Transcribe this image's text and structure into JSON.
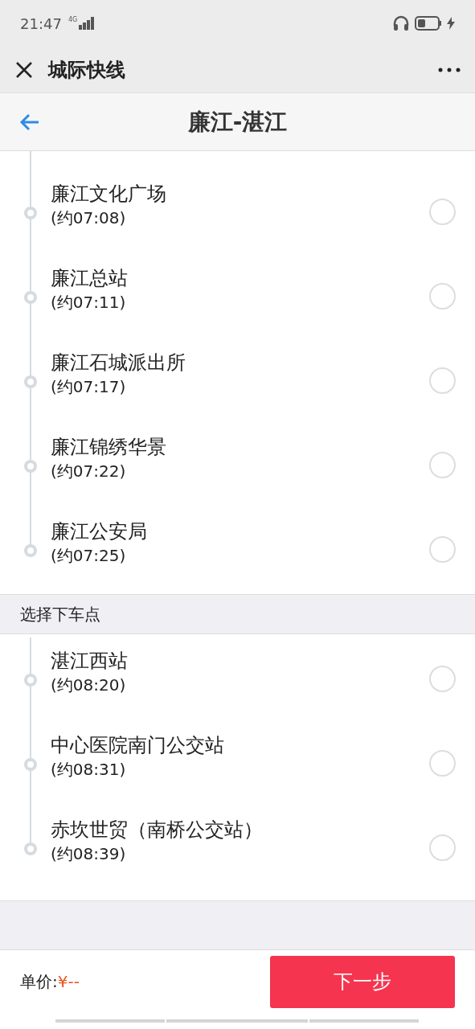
{
  "status_bar": {
    "time": "21:47",
    "network": "4G"
  },
  "title_bar": {
    "title": "城际快线"
  },
  "nav": {
    "title": "廉江-湛江"
  },
  "boarding": {
    "stops": [
      {
        "name": "廉江文化广场",
        "time": "(约07:08)",
        "selected": false
      },
      {
        "name": "廉江总站",
        "time": "(约07:11)",
        "selected": false
      },
      {
        "name": "廉江石城派出所",
        "time": "(约07:17)",
        "selected": false
      },
      {
        "name": "廉江锦绣华景",
        "time": "(约07:22)",
        "selected": false
      },
      {
        "name": "廉江公安局",
        "time": "(约07:25)",
        "selected": false
      }
    ]
  },
  "alighting": {
    "heading": "选择下车点",
    "stops": [
      {
        "name": "湛江西站",
        "time": "(约08:20)",
        "selected": false
      },
      {
        "name": "中心医院南门公交站",
        "time": "(约08:31)",
        "selected": false
      },
      {
        "name": "赤坎世贸（南桥公交站）",
        "time": "(约08:39)",
        "selected": false
      }
    ]
  },
  "footer": {
    "price_label": "单价:",
    "price": "¥--",
    "button": "下一步"
  }
}
